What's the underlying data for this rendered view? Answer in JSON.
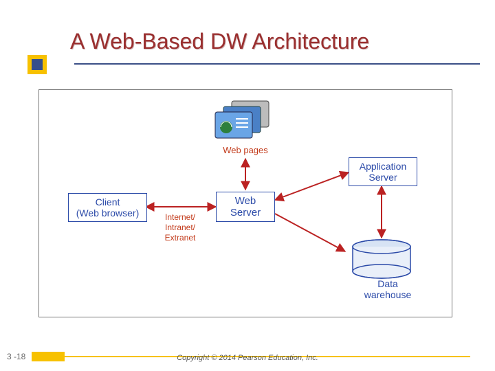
{
  "title": "A Web-Based DW Architecture",
  "slide_number": "3 -18",
  "copyright": "Copyright © 2014 Pearson Education, Inc.",
  "nodes": {
    "client": "Client\n(Web browser)",
    "web_server": "Web\nServer",
    "app_server": "Application\nServer",
    "data_warehouse": "Data\nwarehouse"
  },
  "labels": {
    "web_pages": "Web pages",
    "internet": "Internet/\nIntranet/\nExtranet"
  },
  "icons": {
    "web_pages": "web-pages-icon",
    "db_cylinder": "database-icon"
  },
  "chart_data": {
    "type": "diagram",
    "title": "A Web-Based DW Architecture",
    "nodes": [
      {
        "id": "web_pages",
        "label": "Web pages"
      },
      {
        "id": "client",
        "label": "Client (Web browser)"
      },
      {
        "id": "web_server",
        "label": "Web Server"
      },
      {
        "id": "app_server",
        "label": "Application Server"
      },
      {
        "id": "data_warehouse",
        "label": "Data warehouse"
      }
    ],
    "edges": [
      {
        "from": "web_pages",
        "to": "web_server",
        "bidirectional": true
      },
      {
        "from": "client",
        "to": "web_server",
        "bidirectional": true,
        "label": "Internet/Intranet/Extranet"
      },
      {
        "from": "web_server",
        "to": "app_server",
        "bidirectional": true
      },
      {
        "from": "web_server",
        "to": "data_warehouse",
        "bidirectional": false
      },
      {
        "from": "app_server",
        "to": "data_warehouse",
        "bidirectional": true
      }
    ]
  }
}
